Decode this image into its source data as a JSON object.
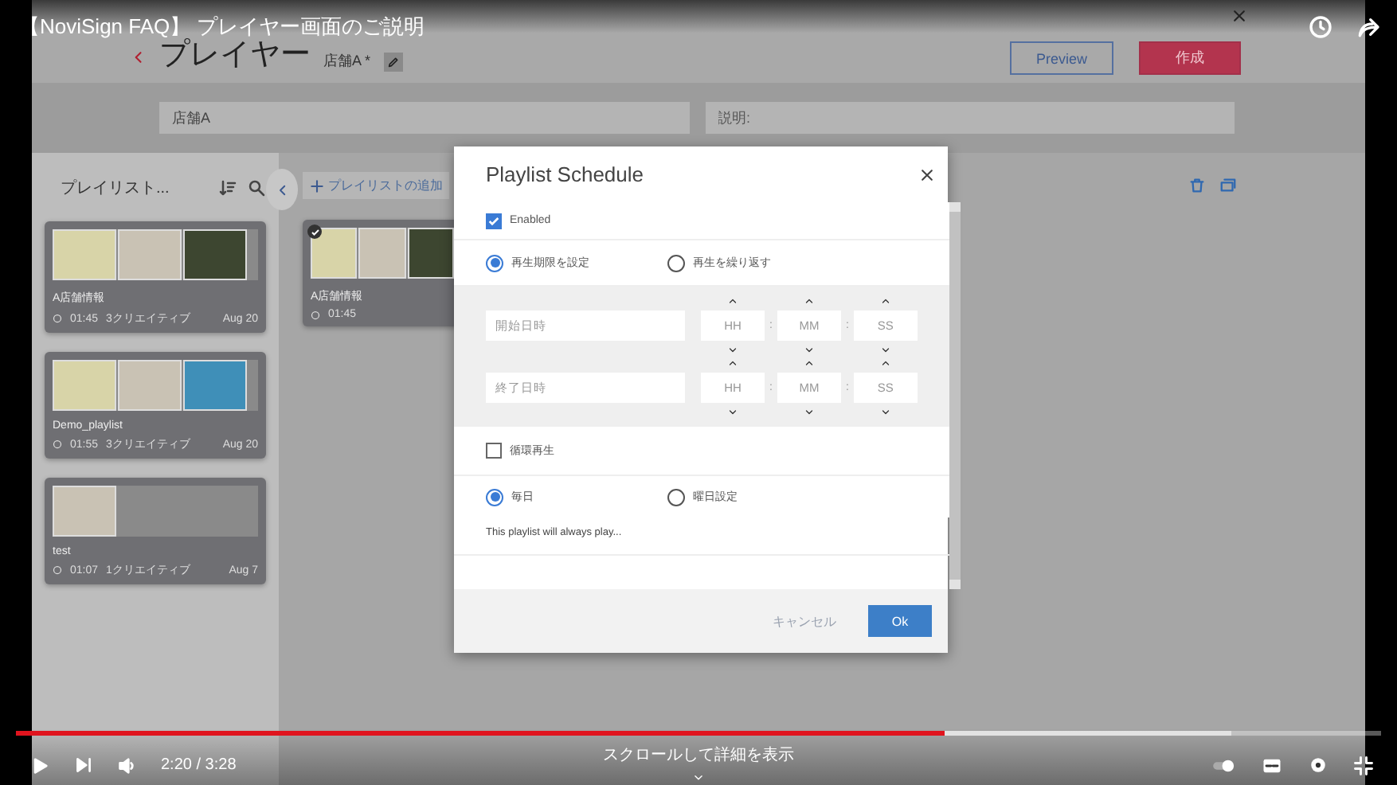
{
  "video_title": "【NoviSign FAQ】 プレイヤー画面のご説明",
  "app": {
    "page_title": "プレイヤー",
    "store_tag": "店舗A *",
    "buttons": [
      {
        "label": "Preview",
        "kind": "outline"
      },
      {
        "label": "作成",
        "kind": "primary"
      }
    ],
    "name_field": {
      "value": "店舗A"
    },
    "description_field": {
      "placeholder": "説明:"
    }
  },
  "sidebar": {
    "title": "プレイリスト...",
    "playlists": [
      {
        "name": "A店舗情報",
        "duration": "01:45",
        "creatives": "3クリエイティブ",
        "date": "Aug 20",
        "thumbnails": [
          {
            "kind": "slide"
          },
          {
            "kind": "video"
          },
          {
            "kind": "photo"
          }
        ]
      },
      {
        "name": "Demo_playlist",
        "duration": "01:55",
        "creatives": "3クリエイティブ",
        "date": "Aug 20",
        "thumbnails": [
          {
            "kind": "slide"
          },
          {
            "kind": "video"
          },
          {
            "kind": "sky"
          }
        ]
      },
      {
        "name": "test",
        "duration": "01:07",
        "creatives": "1クリエイティブ",
        "date": "Aug 7",
        "thumbnails": [
          {
            "kind": "video"
          }
        ]
      }
    ]
  },
  "workspace": {
    "add_button": "プレイリストの追加",
    "playlists": [
      {
        "name": "A店舗情報",
        "duration": "01:45",
        "checked": true,
        "thumbnails": [
          {
            "kind": "slide"
          },
          {
            "kind": "video"
          },
          {
            "kind": "photo"
          }
        ]
      }
    ]
  },
  "dialog": {
    "title": "Playlist Schedule",
    "enabled": {
      "label": "Enabled",
      "checked": true
    },
    "mode_options": [
      {
        "label": "再生期限を設定",
        "selected": true
      },
      {
        "label": "再生を繰り返す",
        "selected": false
      }
    ],
    "date_rows": [
      {
        "placeholder": "開始日時",
        "time_fields": [
          {
            "placeholder": "HH"
          },
          {
            "placeholder": "MM"
          },
          {
            "placeholder": "SS"
          }
        ],
        "separators": [
          ":",
          ":"
        ]
      },
      {
        "placeholder": "終了日時",
        "time_fields": [
          {
            "placeholder": "HH"
          },
          {
            "placeholder": "MM"
          },
          {
            "placeholder": "SS"
          }
        ],
        "separators": [
          ":",
          ":"
        ]
      }
    ],
    "loop": {
      "label": "循環再生",
      "checked": false
    },
    "day_options": [
      {
        "label": "毎日",
        "selected": true
      },
      {
        "label": "曜日設定",
        "selected": false
      }
    ],
    "note": "This playlist will always play...",
    "cancel": "キャンセル",
    "ok": "Ok"
  },
  "player": {
    "time": "2:20 / 3:28",
    "progress": {
      "level": 0.68
    },
    "buffer": {
      "level": 0.89
    },
    "scroll_hint": "スクロールして詳細を表示"
  }
}
